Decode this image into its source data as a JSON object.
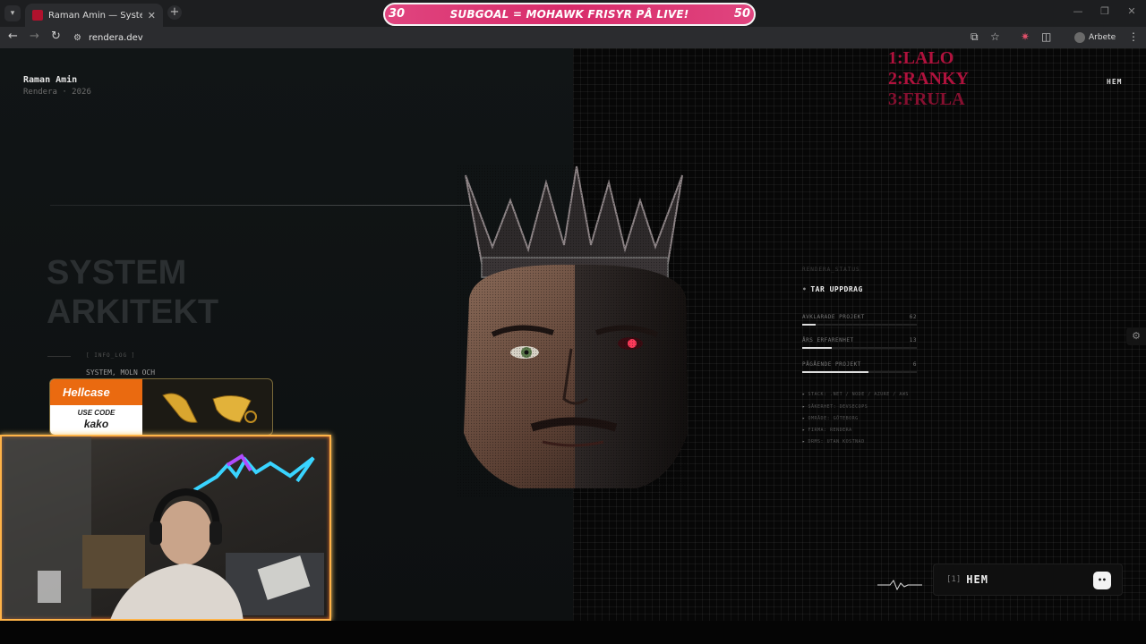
{
  "browser": {
    "tab_title": "Raman Amin — Systemutvecklare",
    "tab_close": "✕",
    "new_tab": "+",
    "url": "rendera.dev",
    "profile_label": "Arbete",
    "back": "←",
    "forward": "→",
    "reload": "↻",
    "minimize": "—",
    "restore": "❐",
    "close": "✕"
  },
  "stream_banner": {
    "left_count": "30",
    "text": "SUBGOAL = MOHAWK FRISYR PÅ LIVE!",
    "right_count": "50",
    "progress": 0.0
  },
  "page": {
    "brand_name": "Raman Amin",
    "brand_sub": "Rendera · 2026",
    "nav_home": "HEM",
    "title_line1": "SYSTEM",
    "title_line2": "ARKITEKT",
    "info_log": "[ INFO_LOG ]",
    "info_text": "SYSTEM, MOLN OCH",
    "leaderboard": [
      "1:LALO",
      "2:RANKY",
      "3:FRULA"
    ],
    "status_label": "RENDERA_STATUS",
    "status": "TAR UPPDRAG",
    "stats": [
      {
        "label": "AVKLARADE PROJEKT",
        "value": "62",
        "fill": 0.12
      },
      {
        "label": "ÅRS ERFARENHET",
        "value": "13",
        "fill": 0.26
      },
      {
        "label": "PÅGÅENDE PROJEKT",
        "value": "6",
        "fill": 0.58
      }
    ],
    "bullets": [
      "STACK: .NET / NODE / AZURE / AWS",
      "SÄKERHET: DEVSECOPS",
      "OMRÅDE: GÖTEBORG",
      "FIRMA: RENDERA",
      "DRMS: UTAN KOSTNAD"
    ],
    "dock_index": "[1]",
    "dock_label": "HEM",
    "dock_chat": "••"
  },
  "overlay": {
    "hellcase_brand": "Hellcase",
    "use_code": "USE CODE",
    "code": "kako"
  },
  "colors": {
    "accent_red": "#b0123d",
    "banner_pink": "#d82b6a",
    "hellcase_orange": "#ea6a10"
  }
}
